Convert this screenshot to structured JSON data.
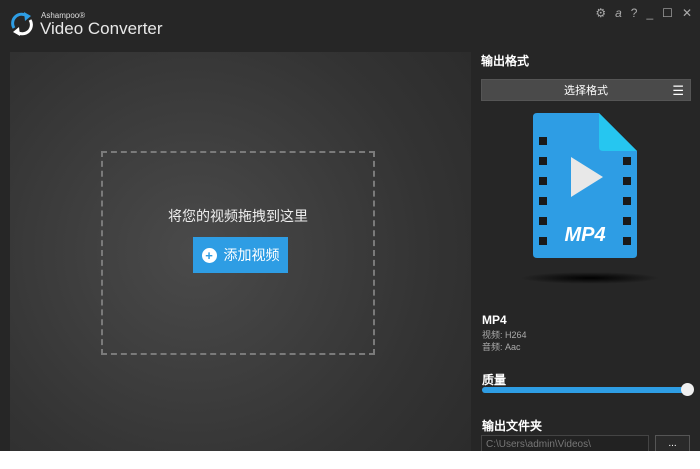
{
  "app": {
    "brand_small": "Ashampoo®",
    "title": "Video Converter"
  },
  "window_controls": [
    "settings",
    "ashampoo",
    "help",
    "minimize",
    "maximize",
    "close"
  ],
  "drop_zone": {
    "hint": "将您的视频拖拽到这里",
    "add_button": "添加视频"
  },
  "sidebar": {
    "output_format_heading": "输出格式",
    "select_format": "选择格式",
    "format_icon_label": "MP4",
    "format_name": "MP4",
    "video_codec": "视频: H264",
    "audio_codec": "音频: Aac",
    "quality_heading": "质量",
    "quality_value": 1.0,
    "output_folder_heading": "输出文件夹",
    "output_folder": "C:\\Users\\admin\\Videos\\",
    "browse_label": "..."
  },
  "colors": {
    "accent": "#2e9de4",
    "background": "#262626"
  }
}
